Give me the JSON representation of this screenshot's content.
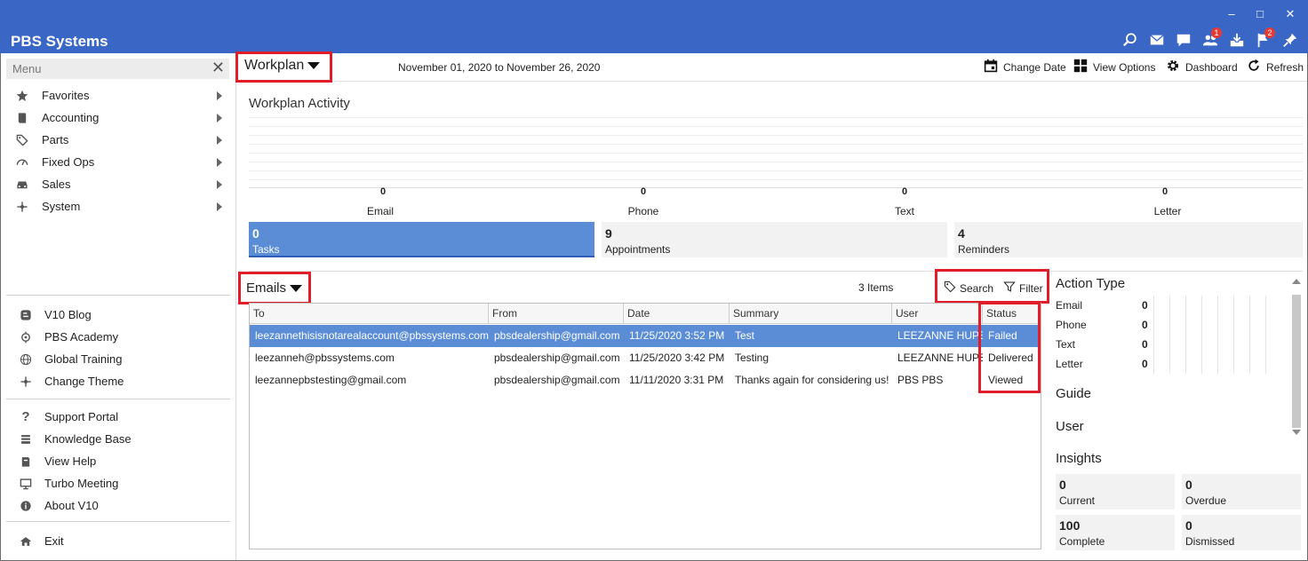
{
  "app": {
    "title": "PBS Systems",
    "window_controls": [
      "–",
      "□",
      "✕"
    ],
    "toolbar_icons": [
      {
        "name": "search-icon"
      },
      {
        "name": "mail-icon"
      },
      {
        "name": "chat-icon"
      },
      {
        "name": "people-icon",
        "badge": "1"
      },
      {
        "name": "inbox-download-icon"
      },
      {
        "name": "flag-icon",
        "badge": "2"
      },
      {
        "name": "pin-icon"
      }
    ]
  },
  "sidebar": {
    "menu_placeholder": "Menu",
    "nav": [
      {
        "label": "Favorites",
        "icon": "star-icon"
      },
      {
        "label": "Accounting",
        "icon": "book-icon"
      },
      {
        "label": "Parts",
        "icon": "tag-icon"
      },
      {
        "label": "Fixed Ops",
        "icon": "gauge-icon"
      },
      {
        "label": "Sales",
        "icon": "car-icon"
      },
      {
        "label": "System",
        "icon": "system-icon"
      }
    ],
    "links1": [
      {
        "label": "V10 Blog",
        "icon": "blogger-icon"
      },
      {
        "label": "PBS Academy",
        "icon": "academy-icon"
      },
      {
        "label": "Global Training",
        "icon": "globe-icon"
      },
      {
        "label": "Change Theme",
        "icon": "theme-icon"
      }
    ],
    "links2": [
      {
        "label": "Support Portal",
        "icon": "question-icon"
      },
      {
        "label": "Knowledge Base",
        "icon": "knowledge-icon"
      },
      {
        "label": "View Help",
        "icon": "help-icon"
      },
      {
        "label": "Turbo Meeting",
        "icon": "meeting-icon"
      },
      {
        "label": "About V10",
        "icon": "info-icon"
      }
    ],
    "exit": {
      "label": "Exit",
      "icon": "exit-icon"
    }
  },
  "header": {
    "workplan_label": "Workplan",
    "date_range": "November 01, 2020 to November 26, 2020",
    "tools": [
      {
        "label": "Change Date",
        "icon": "calendar-icon"
      },
      {
        "label": "View Options",
        "icon": "grid-icon"
      },
      {
        "label": "Dashboard",
        "icon": "gear-icon"
      },
      {
        "label": "Refresh",
        "icon": "refresh-icon"
      }
    ]
  },
  "activity": {
    "title": "Workplan Activity",
    "channels": [
      {
        "label": "Email",
        "count": "0"
      },
      {
        "label": "Phone",
        "count": "0"
      },
      {
        "label": "Text",
        "count": "0"
      },
      {
        "label": "Letter",
        "count": "0"
      }
    ],
    "tiles": [
      {
        "value": "0",
        "label": "Tasks",
        "active": true
      },
      {
        "value": "9",
        "label": "Appointments",
        "active": false
      },
      {
        "value": "4",
        "label": "Reminders",
        "active": false
      }
    ]
  },
  "emails": {
    "label": "Emails",
    "items_count": "3 Items",
    "search_label": "Search",
    "filter_label": "Filter",
    "columns": [
      "To",
      "From",
      "Date",
      "Summary",
      "User",
      "Status"
    ],
    "rows": [
      {
        "to": "leezannethisisnotarealaccount@pbssystems.com",
        "from": "pbsdealership@gmail.com",
        "date": "11/25/2020 3:52 PM",
        "summary": "Test",
        "user": "LEEZANNE HUPE",
        "status": "Failed",
        "selected": true
      },
      {
        "to": "leezanneh@pbssystems.com",
        "from": "pbsdealership@gmail.com",
        "date": "11/25/2020 3:42 PM",
        "summary": "Testing",
        "user": "LEEZANNE HUPE",
        "status": "Delivered",
        "selected": false
      },
      {
        "to": "leezannepbstesting@gmail.com",
        "from": "pbsdealership@gmail.com",
        "date": "11/11/2020 3:31 PM",
        "summary": "Thanks again for considering us!",
        "user": "PBS PBS",
        "status": "Viewed",
        "selected": false
      }
    ]
  },
  "right_panel": {
    "action_type_title": "Action Type",
    "action_types": [
      {
        "label": "Email",
        "value": "0"
      },
      {
        "label": "Phone",
        "value": "0"
      },
      {
        "label": "Text",
        "value": "0"
      },
      {
        "label": "Letter",
        "value": "0"
      }
    ],
    "guide_title": "Guide",
    "user_title": "User",
    "insights_title": "Insights",
    "insights": [
      {
        "value": "0",
        "label": "Current"
      },
      {
        "value": "0",
        "label": "Overdue"
      },
      {
        "value": "100",
        "label": "Complete"
      },
      {
        "value": "0",
        "label": "Dismissed"
      }
    ]
  },
  "colors": {
    "titlebar": "#3a67c6",
    "selection": "#5b8dd6",
    "highlight_box": "#e11d2a"
  }
}
